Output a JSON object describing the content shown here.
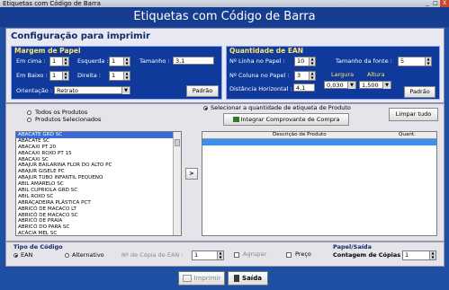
{
  "window": {
    "title": "Etiquetas com Código de Barra",
    "minimize_label": "_",
    "maximize_label": "□",
    "close_label": "X"
  },
  "header": {
    "title": "Etiquetas com Código de Barra"
  },
  "config": {
    "title": "Configuração para imprimir",
    "margem": {
      "caption": "Margem de Papel",
      "em_cima_label": "Em cima :",
      "em_cima": "1",
      "esquerda_label": "Esquerda :",
      "esquerda": "1",
      "tamanho_label": "Tamanho :",
      "tamanho": "3,1",
      "em_baixo_label": "Em Baixo :",
      "em_baixo": "1",
      "direita_label": "Direita :",
      "direita": "1",
      "orientacao_label": "Orientação :",
      "orientacao": "Retrato",
      "padrao_label": "Padrão"
    },
    "quantidade": {
      "caption": "Quantidade de EAN",
      "linha_label": "Nº Linha no Papel :",
      "linha": "10",
      "coluna_label": "Nº Coluna no Papel :",
      "coluna": "3",
      "distancia_label": "Distância Horizontal :",
      "distancia": "4,1",
      "fonte_label": "Tamanho da fonte :",
      "fonte": "5",
      "largura_label": "Largura",
      "largura": "0,030",
      "altura_label": "Altura",
      "altura": "1,500",
      "padrao_label": "Padrão"
    }
  },
  "produtos": {
    "radio_todos": "Todos os Produtos",
    "radio_selecionados": "Produtos Selecionados",
    "radio_quantidade": "Selecionar a quantidade de etiqueta de Produto",
    "integrar_label": "Integrar Comprovante de Compra",
    "limpar_label": "Limpar tudo",
    "move_label": ">",
    "items": [
      "ABACATE GRD SC",
      "ABACATE SC",
      "ABACAXI PT 20",
      "ABACAXI ROXO PT 15",
      "ABACAXI SC",
      "ABAJUR BAILARINA FLOR DO ALTO PC",
      "ABAJUR GISELE PC",
      "ABAJUR TUBO INFANTIL PEQUENO",
      "ABIL AMARELO SC",
      "ABIL CUPRIOLA GRD SC",
      "ABIL ROXO SC",
      "ABRAÇADEIRA PLÁSTICA PCT",
      "ABRICÓ DE MACACO LT",
      "ABRICÓ DE MACACO SC",
      "ABRICÓ DE PRAIA",
      "ABRICÓ DO PARA SC",
      "ACÁCIA MEL SC"
    ],
    "grid_col_desc": "Descrição de Produto",
    "grid_col_quant": "Quant."
  },
  "bottom": {
    "tipo_title": "Tipo de Código",
    "ean_label": "EAN",
    "alternativo_label": "Alternativo",
    "copia_label": "Nº de Cópia de EAN :",
    "copia_value": "1",
    "agrupar_label": "Agrupar",
    "preco_label": "Preço",
    "papel_title": "Papel/Saída",
    "contagem_label": "Contagem de Cópias :",
    "contagem_value": "1"
  },
  "footer": {
    "imprimir_label": "Imprimir",
    "sair_label": "Saída"
  }
}
